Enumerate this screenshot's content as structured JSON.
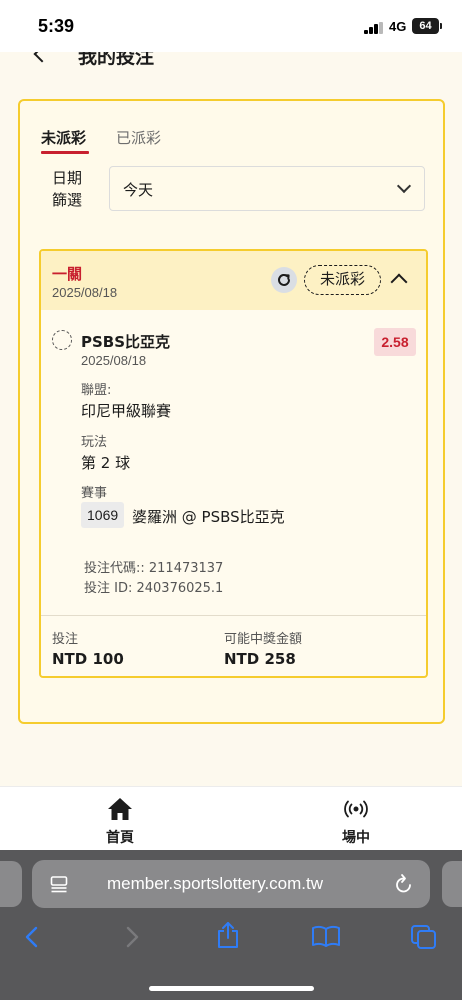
{
  "status_bar": {
    "time": "5:39",
    "network": "4G",
    "battery": "64"
  },
  "header": {
    "title": "我的投注"
  },
  "tabs": [
    {
      "label": "未派彩",
      "active": true
    },
    {
      "label": "已派彩",
      "active": false
    }
  ],
  "filter": {
    "label_line1": "日期",
    "label_line2": "篩選",
    "value": "今天"
  },
  "bet": {
    "type": "一關",
    "date": "2025/08/18",
    "status": "未派彩",
    "selection": "PSBS比亞克",
    "selection_date": "2025/08/18",
    "odds": "2.58",
    "league_label": "聯盟:",
    "league": "印尼甲級聯賽",
    "market_label": "玩法",
    "market": "第 2 球",
    "event_label": "賽事",
    "event_code": "1069",
    "event_match": "婆羅洲 @ PSBS比亞克",
    "bet_code": "投注代碼:: 211473137",
    "bet_id": "投注 ID: 240376025.1",
    "stake_label": "投注",
    "stake": "NTD 100",
    "payout_label": "可能中獎金額",
    "payout": "NTD 258"
  },
  "nav": {
    "home": "首頁",
    "live": "場中"
  },
  "browser": {
    "url": "member.sportslottery.com.tw"
  },
  "colors": {
    "accent_red": "#c8202f",
    "border_yellow": "#f5cc2e",
    "ios_blue": "#2f7cf6"
  }
}
